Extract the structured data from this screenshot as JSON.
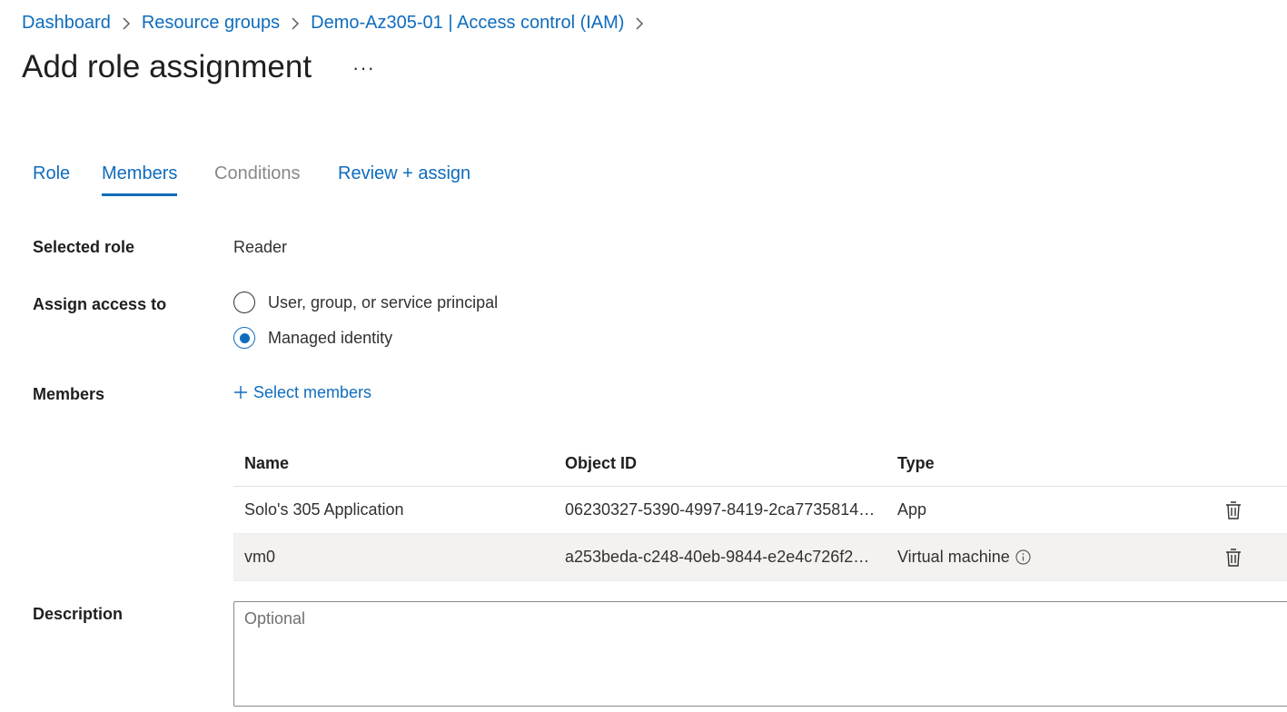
{
  "breadcrumb": {
    "items": [
      "Dashboard",
      "Resource groups",
      "Demo-Az305-01 | Access control (IAM)"
    ]
  },
  "page": {
    "title": "Add role assignment",
    "more_label": "···"
  },
  "tabs": [
    {
      "label": "Role",
      "state": "link"
    },
    {
      "label": "Members",
      "state": "active"
    },
    {
      "label": "Conditions",
      "state": "disabled"
    },
    {
      "label": "Review + assign",
      "state": "link"
    }
  ],
  "form": {
    "selected_role_label": "Selected role",
    "selected_role_value": "Reader",
    "assign_access_label": "Assign access to",
    "assign_options": [
      {
        "label": "User, group, or service principal",
        "checked": false
      },
      {
        "label": "Managed identity",
        "checked": true
      }
    ],
    "members_label": "Members",
    "select_members_label": "Select members",
    "description_label": "Description",
    "description_placeholder": "Optional"
  },
  "members_table": {
    "columns": [
      "Name",
      "Object ID",
      "Type"
    ],
    "rows": [
      {
        "name": "Solo's 305 Application",
        "object_id": "06230327-5390-4997-8419-2ca7735814…",
        "type": "App"
      },
      {
        "name": "vm0",
        "object_id": "a253beda-c248-40eb-9844-e2e4c726f2…",
        "type": "Virtual machine"
      }
    ]
  },
  "colors": {
    "link": "#0f6cbd",
    "text": "#323130",
    "disabled": "#8a8886",
    "row_alt": "#f3f2f1"
  }
}
